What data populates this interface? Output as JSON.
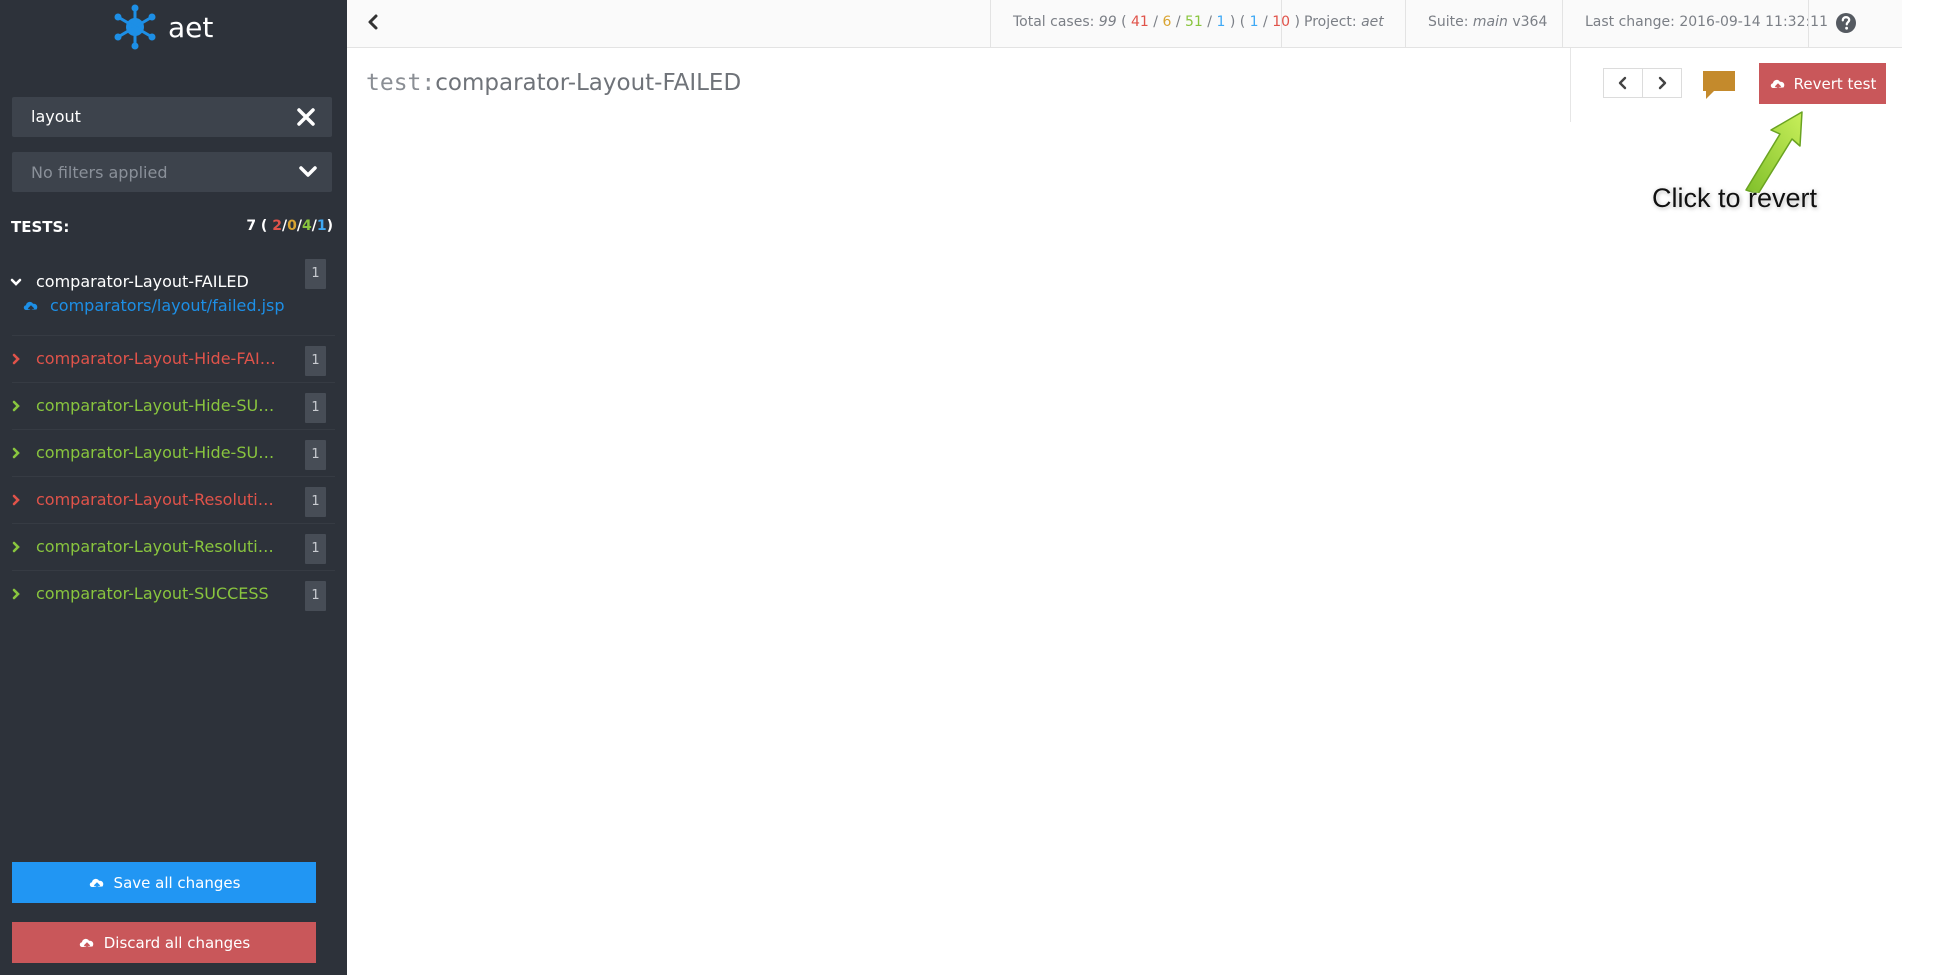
{
  "app": {
    "logo_text": "aet"
  },
  "sidebar": {
    "search_value": "layout",
    "filter_placeholder": "No filters applied",
    "tests_label": "TESTS:",
    "tests_total": "7",
    "tests_counts": {
      "failed": "2",
      "warning": "0",
      "success": "4",
      "info": "1"
    },
    "tests": [
      {
        "name": "comparator-Layout-FAILED",
        "status": "open",
        "count": "1",
        "url": "comparators/layout/failed.jsp"
      },
      {
        "name": "comparator-Layout-Hide-FAILE…",
        "status": "failed",
        "count": "1"
      },
      {
        "name": "comparator-Layout-Hide-SUCC…",
        "status": "success",
        "count": "1"
      },
      {
        "name": "comparator-Layout-Hide-SUCC…",
        "status": "success",
        "count": "1"
      },
      {
        "name": "comparator-Layout-Resolution-…",
        "status": "failed",
        "count": "1"
      },
      {
        "name": "comparator-Layout-Resolution-…",
        "status": "success",
        "count": "1"
      },
      {
        "name": "comparator-Layout-SUCCESS",
        "status": "success",
        "count": "1"
      }
    ],
    "save_label": "Save all changes",
    "discard_label": "Discard all changes"
  },
  "topbar": {
    "total_label": "Total cases:",
    "total": "99",
    "counts": {
      "failed": "41",
      "warning": "6",
      "success": "51",
      "info": "1",
      "rebased": "1",
      "rebased_total": "10"
    },
    "project_label": "Project:",
    "project": "aet",
    "suite_label": "Suite:",
    "suite_name": "main",
    "suite_version": "v364",
    "last_change_label": "Last change:",
    "last_change": "2016-09-14 11:32:11"
  },
  "main": {
    "title_prefix": "test:",
    "title": "comparator-Layout-FAILED",
    "revert_label": "Revert test",
    "annotation": "Click to revert"
  },
  "colors": {
    "sidebar_bg": "#2d323a",
    "accent_blue": "#2196f3",
    "danger": "#c9575a",
    "failed": "#e0534a",
    "warning": "#d9a431",
    "success": "#89c53e",
    "info": "#3fa9f5",
    "comment": "#c48a2c"
  },
  "icons": [
    "logo-icon",
    "close-icon",
    "chevron-down-icon",
    "chevron-right-icon",
    "cloud-upload-icon",
    "chevron-left-icon",
    "help-icon",
    "comment-icon",
    "arrow-annotation"
  ]
}
